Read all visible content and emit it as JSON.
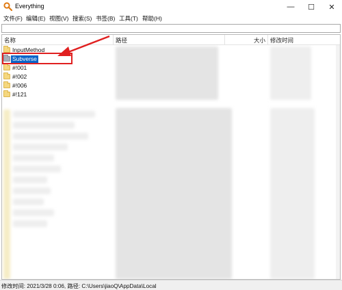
{
  "window": {
    "title": "Everything",
    "min_glyph": "—",
    "max_glyph": "☐",
    "close_glyph": "✕"
  },
  "menu": [
    {
      "label": "文件(F)"
    },
    {
      "label": "编辑(E)"
    },
    {
      "label": "视图(V)"
    },
    {
      "label": "搜索(S)"
    },
    {
      "label": "书签(B)"
    },
    {
      "label": "工具(T)"
    },
    {
      "label": "帮助(H)"
    }
  ],
  "search": {
    "value": "",
    "placeholder": ""
  },
  "columns": {
    "name": "名称",
    "path": "路径",
    "size": "大小",
    "modified": "修改时间"
  },
  "rows": [
    {
      "label": "InputMethod",
      "icon": "folder-icon"
    },
    {
      "label": "Subverse",
      "icon": "folder-icon",
      "selected": true
    },
    {
      "label": "#!001",
      "icon": "folder-icon"
    },
    {
      "label": "#!002",
      "icon": "folder-icon"
    },
    {
      "label": "#!006",
      "icon": "folder-icon"
    },
    {
      "label": "#!121",
      "icon": "folder-icon"
    }
  ],
  "status": {
    "text": "修改时间: 2021/3/28 0:06, 路径: C:\\Users\\jiaoQ\\AppData\\Local"
  },
  "colors": {
    "selection": "#0a64c8",
    "annotation": "#e02020",
    "folder": "#f5d77f"
  }
}
